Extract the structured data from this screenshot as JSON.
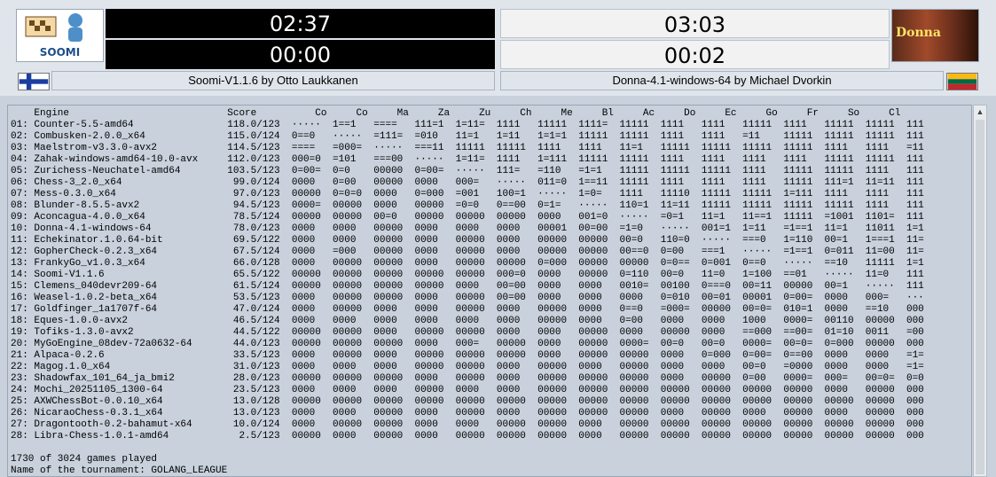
{
  "left": {
    "logo_text": "SOOMI",
    "clock_top": "02:37",
    "clock_bottom": "00:00",
    "name": "Soomi-V1.1.6 by Otto Laukkanen",
    "flag": "finland-flag"
  },
  "right": {
    "logo_text": "Donna",
    "clock_top": "03:03",
    "clock_bottom": "00:02",
    "name": "Donna-4.1-windows-64 by Michael Dvorkin",
    "flag": "lithuania-flag"
  },
  "table": {
    "header": "    Engine                           Score          Co     Co     Ma     Za     Zu     Ch     Me     Bl     Ac     Do     Ec     Go     Fr     So     Cl",
    "rows": [
      "01: Counter-5.5-amd64                118.0/123  ·····  1==1   ====   111=1  1=11=  1111   11111  1111=  11111  1111   1111   11111  1111   11111  11111  111",
      "02: Combusken-2.0.0_x64              115.0/124  0==0   ·····  =111=  =010   11=1   1=11   1=1=1  11111  11111  1111   1111   =11    11111  11111  11111  111",
      "03: Maelstrom-v3.3.0-avx2            114.5/123  ====   =000=  ·····  ===11  11111  11111  1111   1111   11=1   11111  11111  11111  11111  1111   1111   =11",
      "04: Zahak-windows-amd64-10.0-avx     112.0/123  000=0  =101   ===00  ·····  1=11=  1111   1=111  11111  11111  1111   1111   1111   1111   11111  11111  111",
      "05: Zurichess-Neuchatel-amd64        103.5/123  0=00=  0=0    00000  0=00=  ·····  111=   =110   =1=1   11111  11111  11111  1111   11111  11111  1111   111",
      "06: Chess-3_2.0_x64                   99.0/124  0000   0=00   00000  0000   000=   ·····  011=0  1==11  11111  1111   1111   1111   11111  111=1  11=11  111",
      "07: Mess-0.3.0_x64                    97.0/123  00000  0=0=0  0000   0=000  =001   100=1  ·····  1=0=   1111   11110  11111  11111  1=111  1111   1111   111",
      "08: Blunder-8.5.5-avx2                94.5/123  0000=  00000  0000   00000  =0=0   0==00  0=1=   ·····  110=1  11=11  11111  11111  11111  11111  1111   111",
      "09: Aconcagua-4.0.0_x64               78.5/124  00000  00000  00=0   00000  00000  00000  0000   001=0  ·····  =0=1   11=1   11==1  11111  =1001  1101=  111",
      "10: Donna-4.1-windows-64              78.0/123  0000   0000   00000  0000   0000   0000   00001  00=00  =1=0   ·····  001=1  1=11   =1==1  11=1   11011  1=1",
      "11: Echekinator.1.0.64-bit            69.5/122  0000   0000   00000  0000   00000  0000   00000  00000  00=0   110=0  ·····  ===0   1=110  00=1   1===1  11=",
      "12: GopherCheck-0.2.3_x64             67.5/124  0000   =000   00000  0000   00000  0000   00000  00000  00==0  0=00   ===1   ·····  =1==1  0=011  11=00  11=",
      "13: FrankyGo_v1.0.3_x64               66.0/128  0000   00000  00000  0000   00000  00000  0=000  00000  00000  0=0==  0=001  0==0   ·····  ==10   11111  1=1",
      "14: Soomi-V1.1.6                      65.5/122  00000  00000  00000  00000  00000  000=0  0000   00000  0=110  00=0   11=0   1=100  ==01   ·····  11=0   111",
      "15: Clemens_040devr209-64             61.5/124  00000  00000  00000  00000  0000   00=00  0000   0000   0010=  00100  0===0  00=11  00000  00=1   ·····  111",
      "16: Weasel-1.0.2-beta_x64             53.5/123  0000   00000  00000  0000   00000  00=00  0000   0000   0000   0=010  00=01  00001  0=00=  0000   000=   ···",
      "17: Goldfinger_1a1707f-64             47.0/124  0000   00000  0000   0000   00000  0000   00000  0000   0==0   =000=  00000  00=0=  010=1  0000   ==10   000",
      "18: Eques-1.0.0-avx2                  46.5/124  0000   0000   0000   0000   0000   0000   00000  0000   0=00   0000   0000   1000   0000=  00110  00000  000",
      "19: Tofiks-1.3.0-avx2                 44.5/122  00000  00000  0000   00000  00000  0000   0000   00000  0000   00000  0000   ==000  ==00=  01=10  0011   =00",
      "20: MyGoEngine_08dev-72a0632-64       44.0/123  00000  00000  00000  0000   000=   00000  0000   00000  0000=  00=0   00=0   0000=  00=0=  0=000  00000  000",
      "21: Alpaca-0.2.6                      33.5/123  0000   00000  0000   00000  00000  00000  0000   00000  00000  0000   0=000  0=00=  0==00  0000   0000   =1=",
      "22: Magog.1.0_x64                     31.0/123  0000   0000   0000   00000  00000  0000   00000  0000   00000  0000   0000   00=0   =0000  0000   0000   =1=",
      "23: Shadowfax_101_64_ja_bmi2          28.0/123  00000  00000  00000  0000   00000  0000   00000  00000  00000  0000   00000  0=00   0000=  000=   00=0=  0=0",
      "24: Mochi_20251105_1300-64            23.5/123  0000   0000   0000   00000  0000   0000   00000  00000  00000  00000  00000  00000  00000  0000   00000  000",
      "25: AXWChessBot-0.0.10_x64            13.0/128  00000  00000  00000  00000  00000  00000  00000  00000  00000  00000  00000  00000  00000  00000  00000  000",
      "26: NicaraoChess-0.3.1_x64            13.0/123  0000   0000   00000  0000   00000  0000   00000  00000  00000  0000   00000  0000   00000  0000   00000  000",
      "27: Dragontooth-0.2-bahamut-x64       10.0/124  0000   00000  00000  0000   0000   00000  00000  0000   00000  00000  00000  00000  00000  00000  00000  000",
      "28: Libra-Chess-1.0.1-amd64            2.5/123  00000  0000   00000  0000   00000  00000  00000  0000   00000  00000  00000  00000  00000  00000  00000  000"
    ],
    "footer_games": "1730 of 3024 games played",
    "footer_tournament": "Name of the tournament: GOLANG_LEAGUE"
  },
  "colors": {
    "background": "#c8d1dc",
    "clock_dark": "#000000",
    "clock_light": "#f2f2f2"
  },
  "icons": {
    "scroll_up": "chevron-up-icon"
  }
}
